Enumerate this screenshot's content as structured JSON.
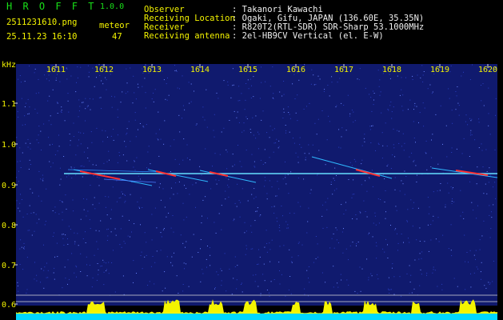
{
  "header": {
    "logo": "H R O F F T",
    "version": "1.0.0",
    "filename": "2511231610.png",
    "datetime": "25.11.23 16:10",
    "meteor_label": "meteor",
    "meteor_count": "47",
    "fields": [
      {
        "label": "Observer",
        "value": ": Takanori Kawachi"
      },
      {
        "label": "Receiving Location",
        "value": ": Ogaki, Gifu, JAPAN (136.60E, 35.35N)"
      },
      {
        "label": "Receiver",
        "value": ": R820T2(RTL-SDR) SDR-Sharp 53.1000MHz"
      },
      {
        "label": "Receiving antenna",
        "value": ": 2el-HB9CV Vertical (el. E-W)"
      }
    ]
  },
  "axes": {
    "y_unit": "kHz",
    "y_ticks": [
      "1.1",
      "1.0",
      "0.9",
      "0.8",
      "0.7",
      "0.6"
    ],
    "x_ticks": [
      "1611",
      "1612",
      "1613",
      "1614",
      "1615",
      "1616",
      "1617",
      "1618",
      "1619",
      "1620"
    ]
  },
  "colors": {
    "noise_bg": "#101a6e",
    "carrier": "#66e0ff",
    "meteor_hot": "#ff3030",
    "level_bars": "#f4f400",
    "level_base": "#00d8ff",
    "text_green": "#19e019",
    "text_yellow": "#f4f400"
  }
}
